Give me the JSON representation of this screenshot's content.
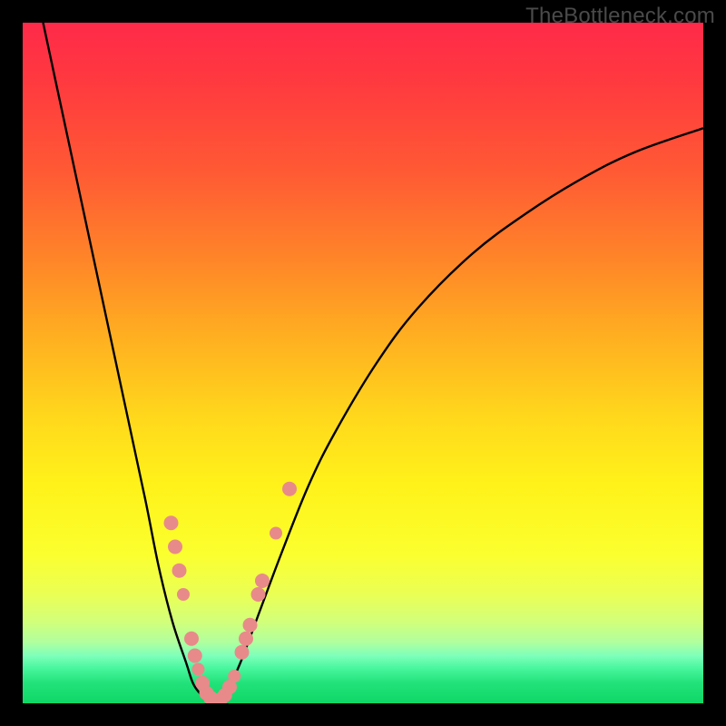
{
  "watermark": "TheBottleneck.com",
  "chart_data": {
    "type": "line",
    "title": "",
    "xlabel": "",
    "ylabel": "",
    "xlim": [
      0,
      100
    ],
    "ylim": [
      0,
      100
    ],
    "series": [
      {
        "name": "curve-left",
        "x": [
          3,
          6,
          9,
          12,
          15,
          18,
          20,
          22,
          24,
          25,
          26,
          27,
          28
        ],
        "y": [
          100,
          86,
          72,
          58,
          44,
          30,
          20,
          12,
          6,
          3,
          1.5,
          0.6,
          0.2
        ]
      },
      {
        "name": "curve-right",
        "x": [
          28,
          30,
          32,
          35,
          38,
          42,
          46,
          52,
          58,
          66,
          74,
          82,
          90,
          100
        ],
        "y": [
          0.2,
          2,
          6,
          14,
          22,
          32,
          40,
          50,
          58,
          66,
          72,
          77,
          81,
          84.5
        ]
      }
    ],
    "markers": {
      "name": "data-points",
      "color": "#e88a8a",
      "points": [
        {
          "x": 21.8,
          "y": 26.5,
          "r": 8
        },
        {
          "x": 22.4,
          "y": 23.0,
          "r": 8
        },
        {
          "x": 23.0,
          "y": 19.5,
          "r": 8
        },
        {
          "x": 23.6,
          "y": 16.0,
          "r": 7
        },
        {
          "x": 24.8,
          "y": 9.5,
          "r": 8
        },
        {
          "x": 25.3,
          "y": 7.0,
          "r": 8
        },
        {
          "x": 25.8,
          "y": 5.0,
          "r": 7
        },
        {
          "x": 26.4,
          "y": 3.0,
          "r": 8
        },
        {
          "x": 27.0,
          "y": 1.5,
          "r": 8
        },
        {
          "x": 27.6,
          "y": 0.8,
          "r": 8
        },
        {
          "x": 28.3,
          "y": 0.4,
          "r": 8
        },
        {
          "x": 29.0,
          "y": 0.5,
          "r": 8
        },
        {
          "x": 29.7,
          "y": 1.2,
          "r": 8
        },
        {
          "x": 30.4,
          "y": 2.4,
          "r": 8
        },
        {
          "x": 31.1,
          "y": 4.0,
          "r": 7
        },
        {
          "x": 32.2,
          "y": 7.5,
          "r": 8
        },
        {
          "x": 32.8,
          "y": 9.5,
          "r": 8
        },
        {
          "x": 33.4,
          "y": 11.5,
          "r": 8
        },
        {
          "x": 34.6,
          "y": 16.0,
          "r": 8
        },
        {
          "x": 35.2,
          "y": 18.0,
          "r": 8
        },
        {
          "x": 37.2,
          "y": 25.0,
          "r": 7
        },
        {
          "x": 39.2,
          "y": 31.5,
          "r": 8
        }
      ]
    }
  }
}
